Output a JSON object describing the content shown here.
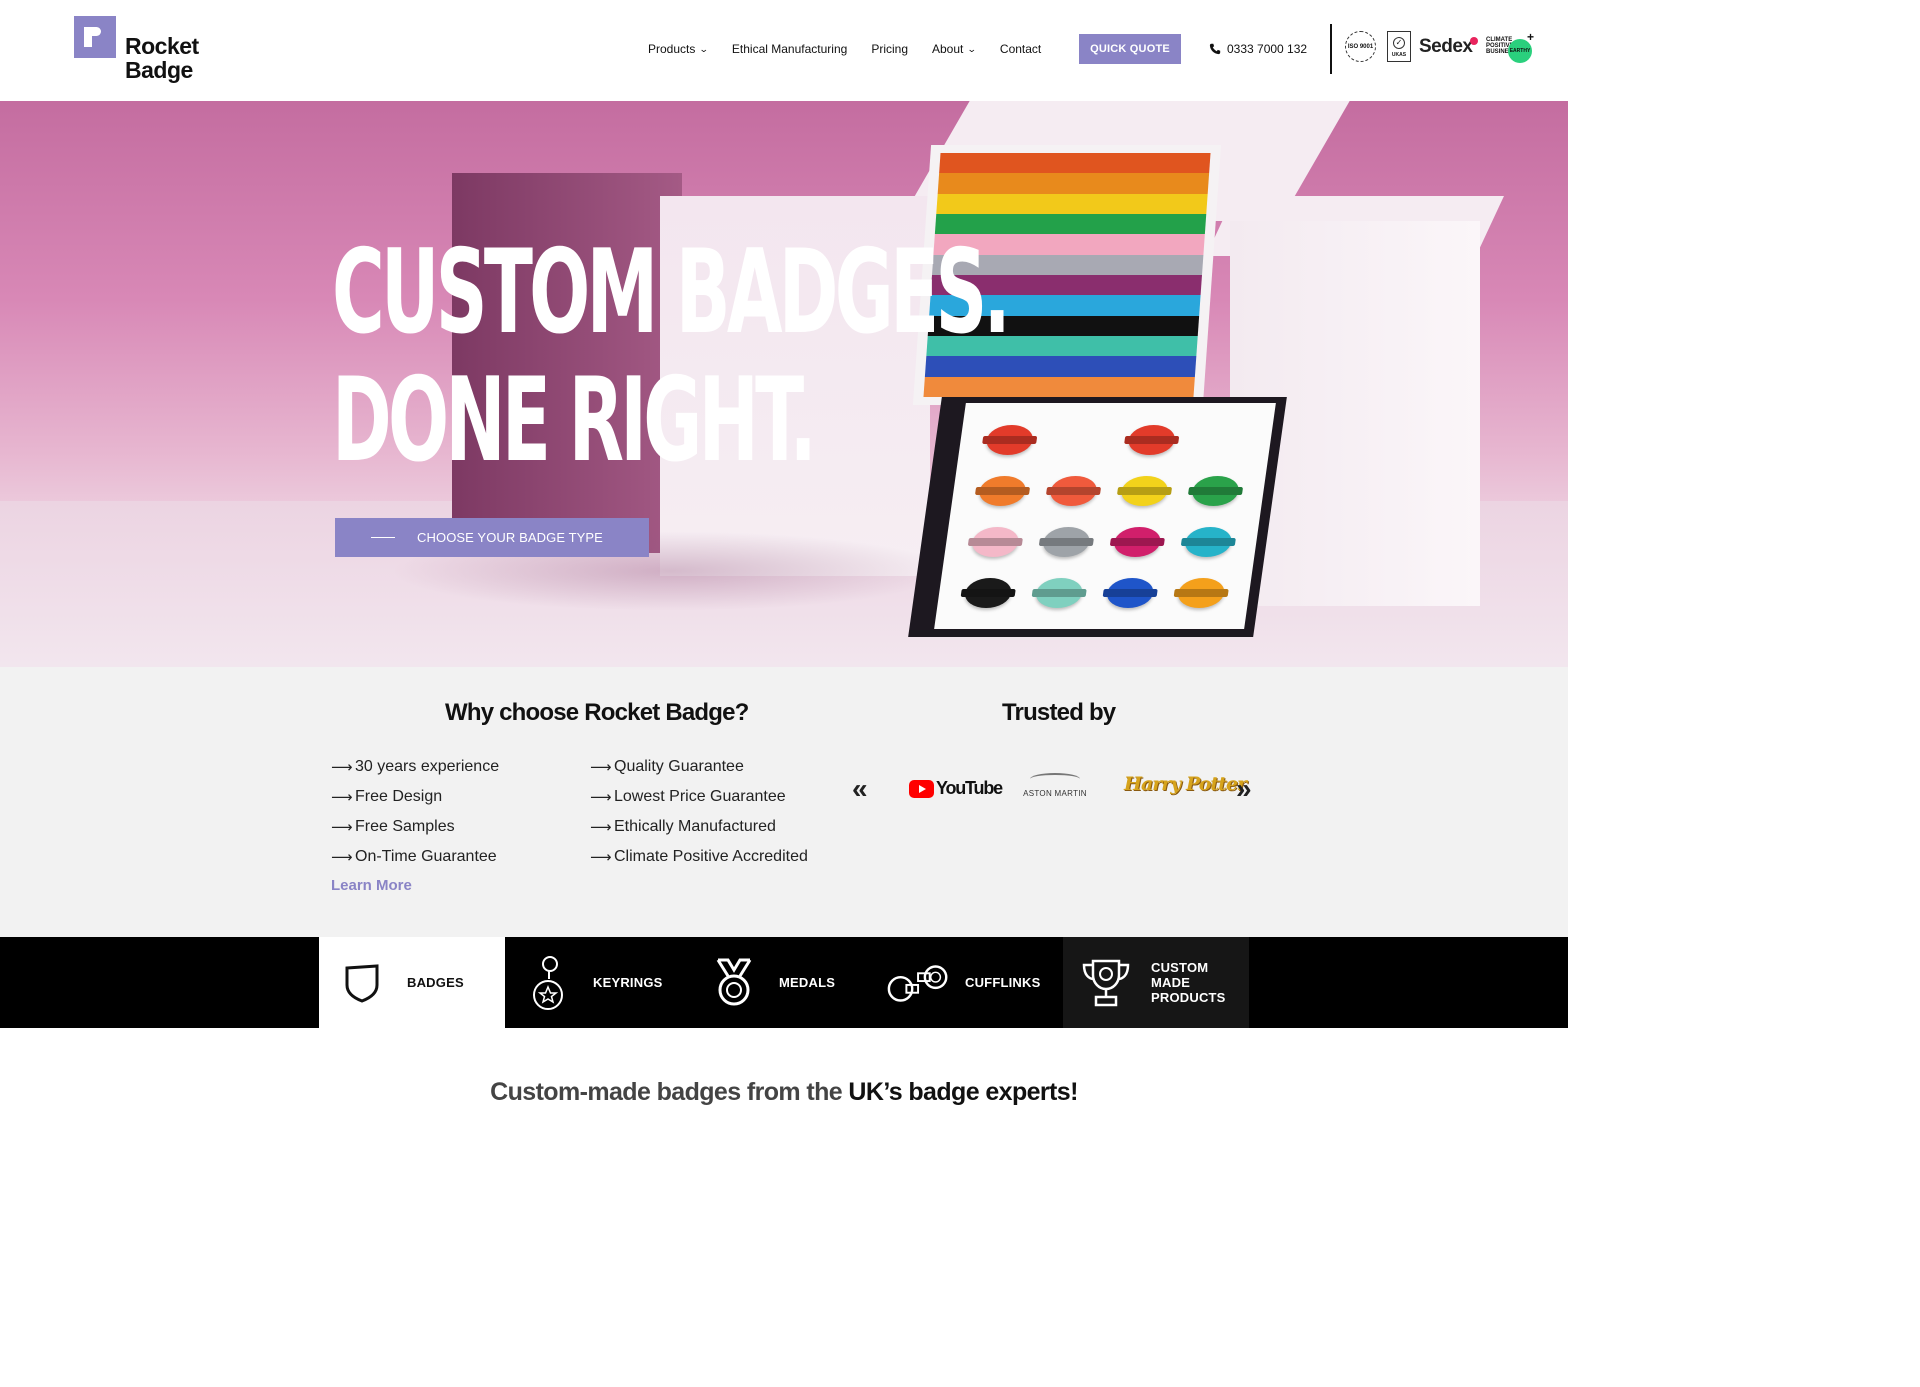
{
  "brand": {
    "name_line1": "Rocket",
    "name_line2": "Badge",
    "accent": "#8a84c6"
  },
  "nav": {
    "items": [
      {
        "label": "Products",
        "has_dropdown": true
      },
      {
        "label": "Ethical Manufacturing",
        "has_dropdown": false
      },
      {
        "label": "Pricing",
        "has_dropdown": false
      },
      {
        "label": "About",
        "has_dropdown": true
      },
      {
        "label": "Contact",
        "has_dropdown": false
      }
    ],
    "quote_button": "QUICK QUOTE",
    "phone": "0333 7000 132",
    "dropdown_icon": "chevron-down-icon",
    "phone_icon": "phone-icon"
  },
  "certifications": {
    "iso": "ISO 9001",
    "ukas": "UKAS",
    "sedex": "Sedex",
    "climate": "CLIMATE POSITIVE BUSINESS",
    "earthy": "EARTHY",
    "plus": "+"
  },
  "hero": {
    "title_line1": "CUSTOM BADGES.",
    "title_line2": "DONE RIGHT.",
    "cta": "CHOOSE YOUR BADGE TYPE",
    "stripe_colors": [
      "#e0551f",
      "#e88a1c",
      "#f2c91a",
      "#23a14a",
      "#f2a7bf",
      "#a8a9b3",
      "#8a2e6e",
      "#2aa7dc",
      "#111111",
      "#3fbfa8",
      "#2d4fb8",
      "#f08a3c"
    ],
    "pin_colors": [
      "#e23b2a",
      "",
      "#e23b2a",
      "",
      "#f07b2b",
      "#f05a3c",
      "#f2d21b",
      "#2aa24a",
      "#f4b8c8",
      "#9ea3a8",
      "#d11f6b",
      "#26b3c9",
      "#1a1a1a",
      "#7fd0bf",
      "#1f55c9",
      "#f4a01b"
    ]
  },
  "why": {
    "title": "Why choose Rocket Badge?",
    "left": [
      "30 years experience",
      "Free Design",
      "Free Samples",
      "On-Time Guarantee"
    ],
    "right": [
      "Quality Guarantee",
      "Lowest Price Guarantee",
      "Ethically Manufactured",
      "Climate Positive Accredited"
    ],
    "arrow": "⟶",
    "learn_more": "Learn More"
  },
  "trusted": {
    "title": "Trusted by",
    "prev": "«",
    "next": "»",
    "logos": {
      "youtube": "YouTube",
      "aston": "ASTON MARTIN",
      "harry": "Harry Potter"
    }
  },
  "categories": [
    {
      "label": "BADGES",
      "icon": "shield-icon"
    },
    {
      "label": "KEYRINGS",
      "icon": "keyring-icon"
    },
    {
      "label": "MEDALS",
      "icon": "medal-icon"
    },
    {
      "label": "CUFFLINKS",
      "icon": "cufflinks-icon"
    },
    {
      "label": "CUSTOM MADE PRODUCTS",
      "icon": "trophy-icon"
    }
  ],
  "tagline": {
    "normal": "Custom-made badges from the ",
    "bold": "UK’s badge experts!"
  }
}
